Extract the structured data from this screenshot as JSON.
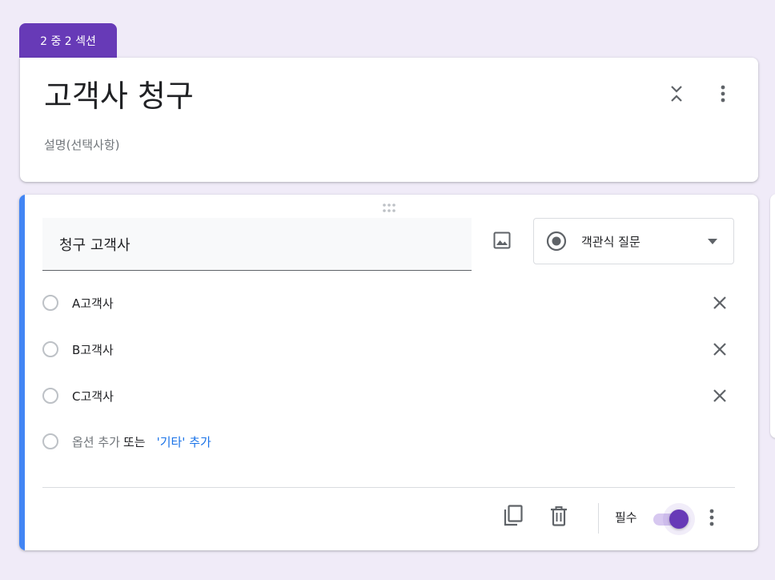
{
  "section_badge": "2 중 2 섹션",
  "header": {
    "title": "고객사 청구",
    "description_placeholder": "설명(선택사항)"
  },
  "question": {
    "title": "청구 고객사",
    "type_label": "객관식 질문",
    "options": [
      {
        "label": "A고객사"
      },
      {
        "label": "B고객사"
      },
      {
        "label": "C고객사"
      }
    ],
    "add_option_text": "옵션 추가",
    "add_or": "또는",
    "add_other_text": "'기타' 추가",
    "required_label": "필수",
    "required": true
  },
  "colors": {
    "accent": "#673ab7",
    "active_bar": "#4285f4",
    "background": "#f0ebf8"
  },
  "icons": [
    "collapse-icon",
    "more-vert-icon",
    "drag-handle-icon",
    "image-icon",
    "radio-button-icon",
    "dropdown-caret-icon",
    "close-icon",
    "copy-icon",
    "delete-icon"
  ]
}
